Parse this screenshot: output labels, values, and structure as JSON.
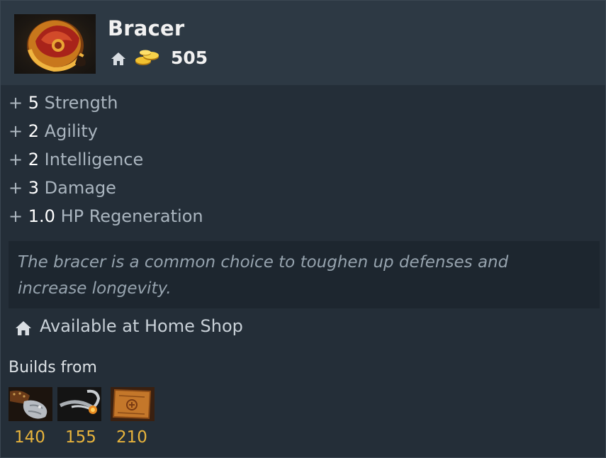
{
  "item": {
    "name": "Bracer",
    "icon": "bracer-item-icon",
    "cost": "505",
    "shop_icon": "home-icon",
    "gold_icon": "gold-coins-icon"
  },
  "stats": [
    {
      "plus": "+",
      "value": "5",
      "label": "Strength"
    },
    {
      "plus": "+",
      "value": "2",
      "label": "Agility"
    },
    {
      "plus": "+",
      "value": "2",
      "label": "Intelligence"
    },
    {
      "plus": "+",
      "value": "3",
      "label": "Damage"
    },
    {
      "plus": "+",
      "value": "1.0",
      "label": "HP Regeneration"
    }
  ],
  "lore": {
    "line1": "The bracer is a common choice to toughen up defenses and",
    "line2": "increase longevity."
  },
  "availability": {
    "icon": "home-icon",
    "text": "Available at Home Shop"
  },
  "builds_from": {
    "label": "Builds from",
    "components": [
      {
        "icon": "gauntlets-of-strength-icon",
        "cost": "140"
      },
      {
        "icon": "circlet-icon",
        "cost": "155"
      },
      {
        "icon": "recipe-scroll-icon",
        "cost": "210"
      }
    ]
  },
  "colors": {
    "gold": "#e8b43c",
    "header_bg": "#2d3944",
    "body_bg": "#242e38",
    "lore_bg": "#1d262f"
  }
}
